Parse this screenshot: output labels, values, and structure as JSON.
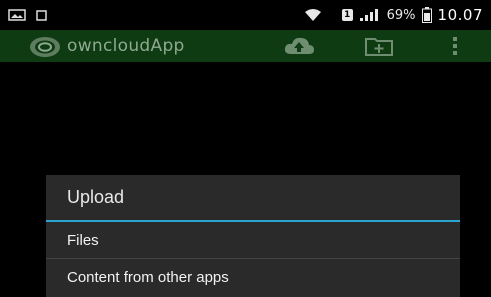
{
  "status_bar": {
    "sim_label": "1",
    "battery": "69%",
    "time": "10.07"
  },
  "action_bar": {
    "app_title": "owncloudApp"
  },
  "dialog": {
    "title": "Upload",
    "items": [
      {
        "label": "Files"
      },
      {
        "label": "Content from other apps"
      }
    ]
  },
  "colors": {
    "action_bar": "#0e3b12",
    "accent": "#2aa4cf",
    "dialog_bg": "#2a2a2a"
  }
}
